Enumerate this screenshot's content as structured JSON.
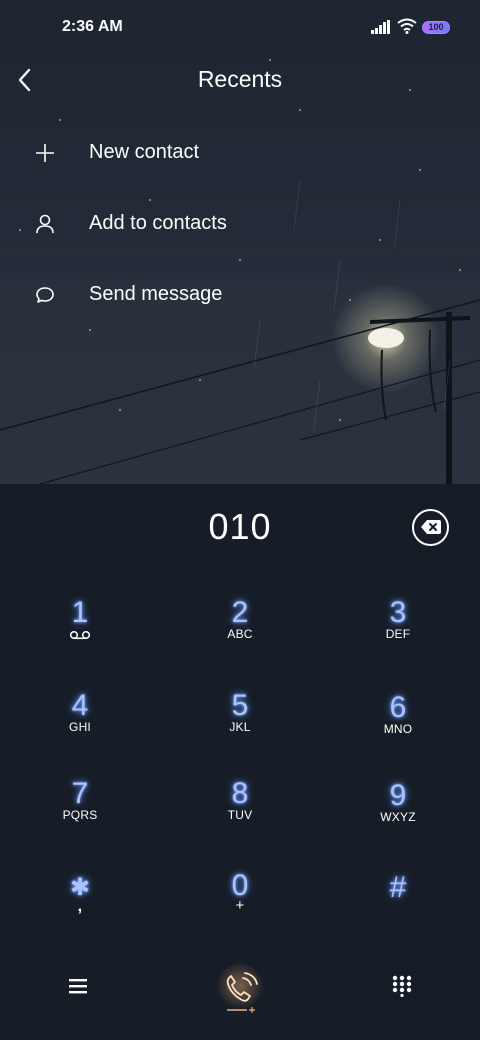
{
  "status_bar": {
    "time": "2:36 AM",
    "battery": "100"
  },
  "header": {
    "title": "Recents"
  },
  "actions": [
    {
      "label": "New contact",
      "icon": "plus-icon"
    },
    {
      "label": "Add to contacts",
      "icon": "person-icon"
    },
    {
      "label": "Send message",
      "icon": "chat-bubble-icon"
    }
  ],
  "dialer": {
    "number": "010",
    "keys": [
      {
        "digit": "1",
        "letters": ""
      },
      {
        "digit": "2",
        "letters": "ABC"
      },
      {
        "digit": "3",
        "letters": "DEF"
      },
      {
        "digit": "4",
        "letters": "GHI"
      },
      {
        "digit": "5",
        "letters": "JKL"
      },
      {
        "digit": "6",
        "letters": "MNO"
      },
      {
        "digit": "7",
        "letters": "PQRS"
      },
      {
        "digit": "8",
        "letters": "TUV"
      },
      {
        "digit": "9",
        "letters": "WXYZ"
      },
      {
        "digit": "✱",
        "letters": ","
      },
      {
        "digit": "0",
        "letters": "+"
      },
      {
        "digit": "#",
        "letters": ""
      }
    ]
  },
  "colors": {
    "digit_glow": "#a9c4ff",
    "panel_bg": "#161d27",
    "call_accent": "#f2b27a"
  }
}
